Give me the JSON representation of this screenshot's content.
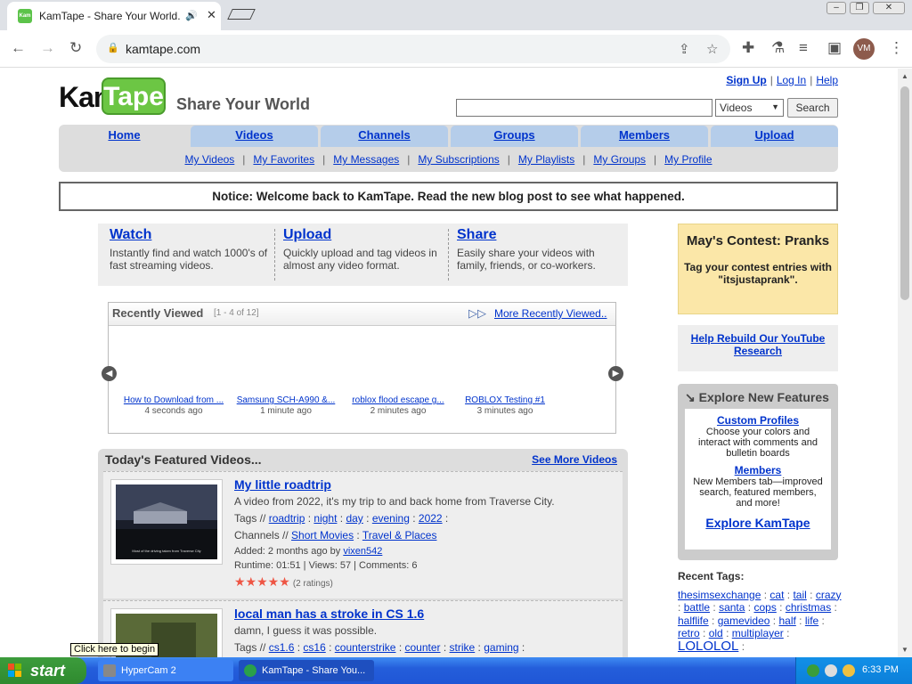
{
  "browser": {
    "tab_title": "KamTape - Share Your World.",
    "url": "kamtape.com",
    "avatar_initials": "VM"
  },
  "site": {
    "logo_kam": "Kam",
    "logo_tape": "Tape",
    "tagline": "Share Your World",
    "util_nav": [
      "Sign Up",
      "Log In",
      "Help"
    ],
    "search_category": "Videos",
    "search_button": "Search",
    "main_tabs": [
      "Home",
      "Videos",
      "Channels",
      "Groups",
      "Members",
      "Upload"
    ],
    "sub_nav": [
      "My Videos",
      "My Favorites",
      "My Messages",
      "My Subscriptions",
      "My Playlists",
      "My Groups",
      "My Profile"
    ],
    "notice": "Notice: Welcome back to KamTape. Read the new blog post to see what happened."
  },
  "wus": [
    {
      "title": "Watch",
      "desc": "Instantly find and watch 1000's of fast streaming videos."
    },
    {
      "title": "Upload",
      "desc": "Quickly upload and tag videos in almost any video format."
    },
    {
      "title": "Share",
      "desc": "Easily share your videos with family, friends, or co-workers."
    }
  ],
  "recently_viewed": {
    "title": "Recently Viewed",
    "count": "[1 - 4 of 12]",
    "more": "More Recently Viewed..",
    "items": [
      {
        "title": "How to Download from ...",
        "ago": "4 seconds ago"
      },
      {
        "title": "Samsung SCH-A990 &...",
        "ago": "1 minute ago"
      },
      {
        "title": "roblox flood escape g...",
        "ago": "2 minutes ago"
      },
      {
        "title": "ROBLOX Testing #1",
        "ago": "3 minutes ago"
      }
    ]
  },
  "featured": {
    "title": "Today's Featured Videos...",
    "see_more": "See More Videos",
    "videos": [
      {
        "title": "My little roadtrip",
        "desc": "A video from 2022, it's my trip to and back home from Traverse City.",
        "tags_label": "Tags //",
        "tags": [
          "roadtrip",
          "night",
          "day",
          "evening",
          "2022"
        ],
        "channels_label": "Channels //",
        "channels": [
          "Short Movies",
          "Travel & Places"
        ],
        "added": "Added: 2 months ago by",
        "user": "vixen542",
        "stats": "Runtime: 01:51 | Views: 57 | Comments: 6",
        "ratings": "(2 ratings)",
        "thumb_caption": "Most of the driving taken from Traverse City",
        "rating_fraction": 1.0
      },
      {
        "title": "local man has a stroke in CS 1.6",
        "desc": "damn, I guess it was possible.",
        "tags_label": "Tags //",
        "tags": [
          "cs1.6",
          "cs16",
          "counterstrike",
          "counter",
          "strike",
          "gaming"
        ]
      }
    ]
  },
  "sidebar": {
    "contest_title": "May's Contest: Pranks",
    "contest_desc": "Tag your contest entries with \"itsjustaprank\".",
    "rebuild": "Help Rebuild Our YouTube Research",
    "explore_title": "Explore New Features",
    "features": [
      {
        "title": "Custom Profiles",
        "desc": "Choose your colors and interact with comments and bulletin boards"
      },
      {
        "title": "Members",
        "desc": "New Members tab—improved search, featured members, and more!"
      }
    ],
    "explore_link": "Explore KamTape",
    "recent_tags_title": "Recent Tags:",
    "recent_tags": [
      "thesimsexchange",
      "cat",
      "tail",
      "crazy",
      "battle",
      "santa",
      "cops",
      "christmas",
      "halflife",
      "gamevideo",
      "half",
      "life",
      "retro",
      "old",
      "multiplayer",
      "LOLOLOL"
    ]
  },
  "taskbar": {
    "start": "start",
    "tooltip": "Click here to begin",
    "buttons": [
      "HyperCam 2",
      "KamTape - Share You..."
    ],
    "time": "6:33 PM"
  }
}
